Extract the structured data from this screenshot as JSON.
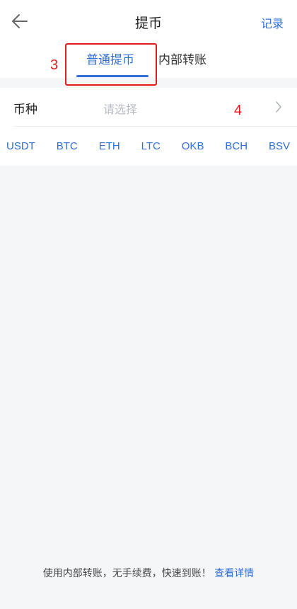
{
  "header": {
    "title": "提币",
    "record_label": "记录"
  },
  "tabs": [
    {
      "label": "普通提币",
      "active": true
    },
    {
      "label": "内部转账",
      "active": false
    }
  ],
  "annotations": [
    "3",
    "4"
  ],
  "form": {
    "coin_label": "币种",
    "coin_placeholder": "请选择"
  },
  "coins": [
    "USDT",
    "BTC",
    "ETH",
    "LTC",
    "OKB",
    "BCH",
    "BSV"
  ],
  "footer": {
    "text": "使用内部转账，无手续费，快速到账！",
    "link": "查看详情"
  },
  "colors": {
    "accent": "#2f6fd6",
    "annotation": "#e41c1c",
    "background": "#f5f6f8"
  },
  "icons": [
    "back-arrow-icon",
    "chevron-right-icon"
  ]
}
